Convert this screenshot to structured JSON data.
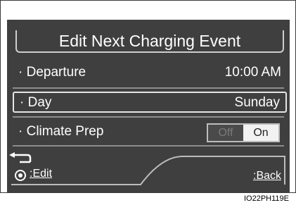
{
  "screen": {
    "title": "Edit Next Charging Event",
    "departure": {
      "label": "· Departure",
      "value": "10:00 AM"
    },
    "day": {
      "label": "· Day",
      "value": "Sunday"
    },
    "climate_prep": {
      "label": "· Climate Prep",
      "off_label": "Off",
      "on_label": "On",
      "selected": "On"
    },
    "bottom_bar": {
      "edit_label": ":Edit",
      "back_label": ":Back",
      "edit_icon": "dial-press-icon",
      "back_icon": "back-arrow-icon"
    }
  },
  "figure_code": "IO22PH119E",
  "colors": {
    "screen_bg": "#3f3f3f",
    "text": "#ffffff",
    "divider": "#8c8c8c"
  }
}
